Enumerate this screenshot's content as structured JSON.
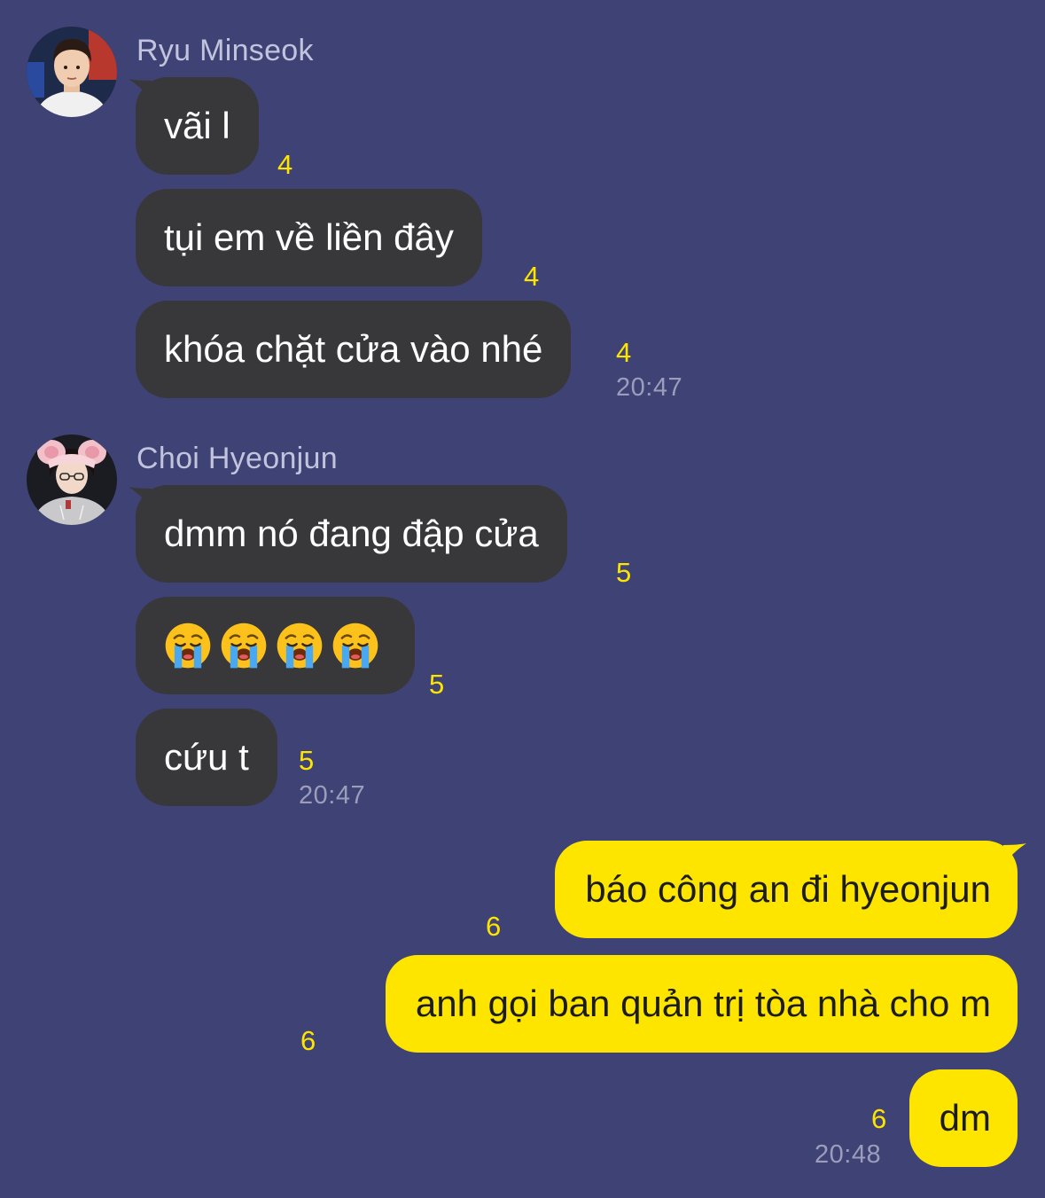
{
  "groups": [
    {
      "sender": "Ryu Minseok",
      "avatar_icon": "user-avatar-photo",
      "messages": [
        {
          "text": "vãi l",
          "count": "4"
        },
        {
          "text": "tụi em về liền đây",
          "count": "4"
        },
        {
          "text": "khóa chặt cửa vào nhé",
          "count": "4",
          "time": "20:47"
        }
      ]
    },
    {
      "sender": "Choi Hyeonjun",
      "avatar_icon": "user-avatar-photo",
      "messages": [
        {
          "text": "dmm nó đang đập cửa",
          "count": "5"
        },
        {
          "emoji": "loudly-crying-face",
          "emoji_count": 4,
          "count": "5"
        },
        {
          "text": "cứu t",
          "count": "5",
          "time": "20:47"
        }
      ]
    }
  ],
  "outgoing": {
    "messages": [
      {
        "text": "báo công an đi hyeonjun",
        "count": "6"
      },
      {
        "text": "anh gọi ban quản trị tòa nhà cho m",
        "count": "6"
      },
      {
        "text": "dm",
        "count": "6",
        "time": "20:48"
      }
    ]
  },
  "colors": {
    "background": "#3f4274",
    "incoming_bubble": "#38383b",
    "outgoing_bubble": "#fde500",
    "unread_count": "#fde500",
    "timestamp": "#9b9dbb"
  }
}
